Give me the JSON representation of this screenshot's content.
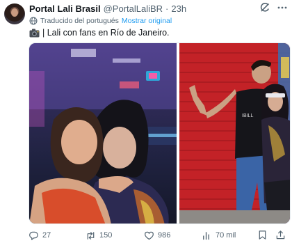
{
  "author": {
    "name": "Portal Lali Brasil",
    "handle": "@PortalLaliBR",
    "separator": "·",
    "time": "23h"
  },
  "translation": {
    "notice": "Traducido del portugués",
    "show_original": "Mostrar original"
  },
  "tweet": {
    "camera_emoji": "📸",
    "text": "| Lali con fans en Río de Janeiro."
  },
  "actions": {
    "replies": "27",
    "retweets": "150",
    "likes": "986",
    "views": "70 mil"
  },
  "colors": {
    "link": "#1d9bf0",
    "secondary_text": "#536471",
    "primary_text": "#0f1419"
  },
  "icons": [
    "grok-icon",
    "more-icon",
    "translate-icon",
    "camera-icon",
    "reply-icon",
    "retweet-icon",
    "like-icon",
    "views-icon",
    "bookmark-icon",
    "share-icon"
  ]
}
